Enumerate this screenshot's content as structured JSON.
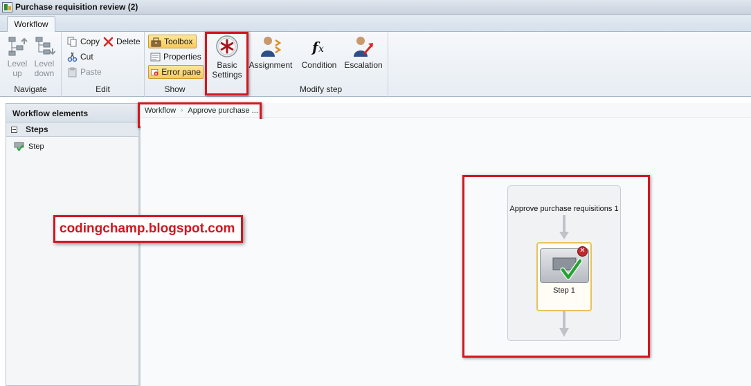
{
  "window": {
    "title": "Purchase requisition review (2)"
  },
  "ribbon": {
    "active_tab": "Workflow",
    "groups": {
      "navigate": {
        "label": "Navigate",
        "level_up": "Level up",
        "level_down": "Level down"
      },
      "edit": {
        "label": "Edit",
        "copy": "Copy",
        "delete": "Delete",
        "cut": "Cut",
        "paste": "Paste"
      },
      "show": {
        "label": "Show",
        "toolbox": "Toolbox",
        "properties": "Properties",
        "error_pane": "Error pane"
      },
      "modify_step": {
        "label": "Modify step",
        "basic_settings": "Basic Settings",
        "assignment": "Assignment",
        "condition": "Condition",
        "escalation": "Escalation"
      }
    }
  },
  "left_panel": {
    "header": "Workflow elements",
    "section": "Steps",
    "items": [
      {
        "label": "Step"
      }
    ]
  },
  "breadcrumb": {
    "items": [
      "Workflow",
      "Approve purchase ..."
    ]
  },
  "watermark": "codingchamp.blogspot.com",
  "workflow": {
    "container_title": "Approve purchase requisitions 1",
    "step_label": "Step 1"
  },
  "colors": {
    "highlight_red": "#d2161f",
    "step_border": "#e8c25a",
    "error_red": "#c1272d"
  },
  "icons": [
    "app-icon",
    "level-up-icon",
    "level-down-icon",
    "copy-icon",
    "delete-icon",
    "cut-icon",
    "paste-icon",
    "toolbox-icon",
    "properties-icon",
    "error-pane-icon",
    "basic-settings-icon",
    "assignment-icon",
    "condition-icon",
    "escalation-icon",
    "step-icon",
    "collapse-icon",
    "error-badge-icon"
  ]
}
